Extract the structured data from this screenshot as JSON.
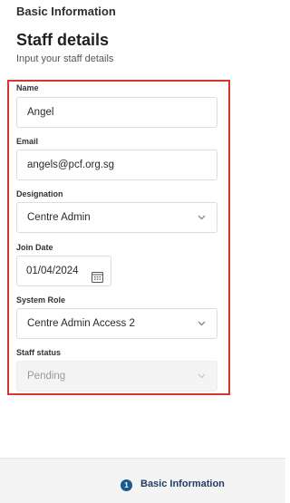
{
  "header": {
    "section_title": "Basic Information",
    "page_title": "Staff details",
    "page_subtitle": "Input your staff details"
  },
  "form": {
    "name": {
      "label": "Name",
      "value": "Angel"
    },
    "email": {
      "label": "Email",
      "value": "angels@pcf.org.sg"
    },
    "designation": {
      "label": "Designation",
      "value": "Centre Admin"
    },
    "join_date": {
      "label": "Join Date",
      "value": "01/04/2024"
    },
    "system_role": {
      "label": "System Role",
      "value": "Centre Admin Access 2"
    },
    "staff_status": {
      "label": "Staff status",
      "value": "Pending",
      "disabled": true
    }
  },
  "footer": {
    "step_number": "1",
    "step_label": "Basic Information"
  },
  "colors": {
    "highlight_border": "#d9352b",
    "step_accent": "#1a5b8f"
  },
  "icons": {
    "select_chevron": "chevron-down-icon",
    "date_picker": "calendar-icon"
  }
}
